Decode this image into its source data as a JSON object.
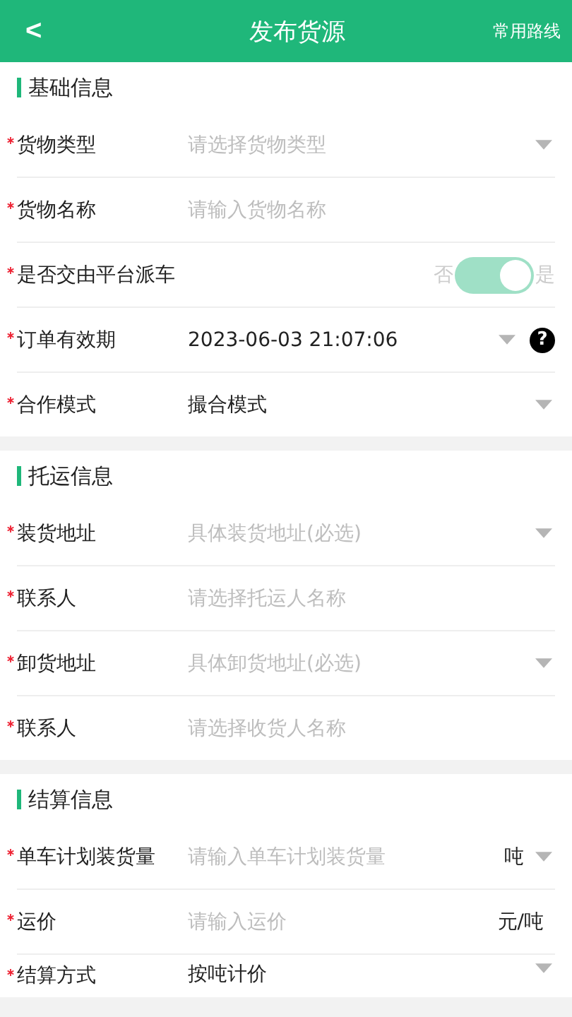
{
  "header": {
    "back": "<",
    "title": "发布货源",
    "action": "常用路线"
  },
  "sections": [
    {
      "title": "基础信息",
      "rows": [
        {
          "kind": "select",
          "label": "货物类型",
          "required": true,
          "placeholder": "请选择货物类型"
        },
        {
          "kind": "input",
          "label": "货物名称",
          "required": true,
          "placeholder": "请输入货物名称"
        },
        {
          "kind": "toggle",
          "label": "是否交由平台派车",
          "required": true,
          "off_label": "否",
          "on_label": "是",
          "on": true
        },
        {
          "kind": "select",
          "label": "订单有效期",
          "required": true,
          "value": "2023-06-03 21:07:06",
          "help": "?"
        },
        {
          "kind": "select",
          "label": "合作模式",
          "required": true,
          "value": "撮合模式"
        }
      ]
    },
    {
      "title": "托运信息",
      "rows": [
        {
          "kind": "select",
          "label": "装货地址",
          "required": true,
          "placeholder": "具体装货地址(必选)"
        },
        {
          "kind": "input",
          "label": "联系人",
          "required": true,
          "placeholder": "请选择托运人名称"
        },
        {
          "kind": "select",
          "label": "卸货地址",
          "required": true,
          "placeholder": "具体卸货地址(必选)"
        },
        {
          "kind": "input",
          "label": "联系人",
          "required": true,
          "placeholder": "请选择收货人名称"
        }
      ]
    },
    {
      "title": "结算信息",
      "rows": [
        {
          "kind": "unit",
          "label": "单车计划装货量",
          "required": true,
          "placeholder": "请输入单车计划装货量",
          "unit": "吨"
        },
        {
          "kind": "input",
          "label": "运价",
          "required": true,
          "placeholder": "请输入运价",
          "suffix": "元/吨"
        },
        {
          "kind": "select",
          "label": "结算方式",
          "required": true,
          "value": "按吨计价"
        }
      ]
    }
  ]
}
